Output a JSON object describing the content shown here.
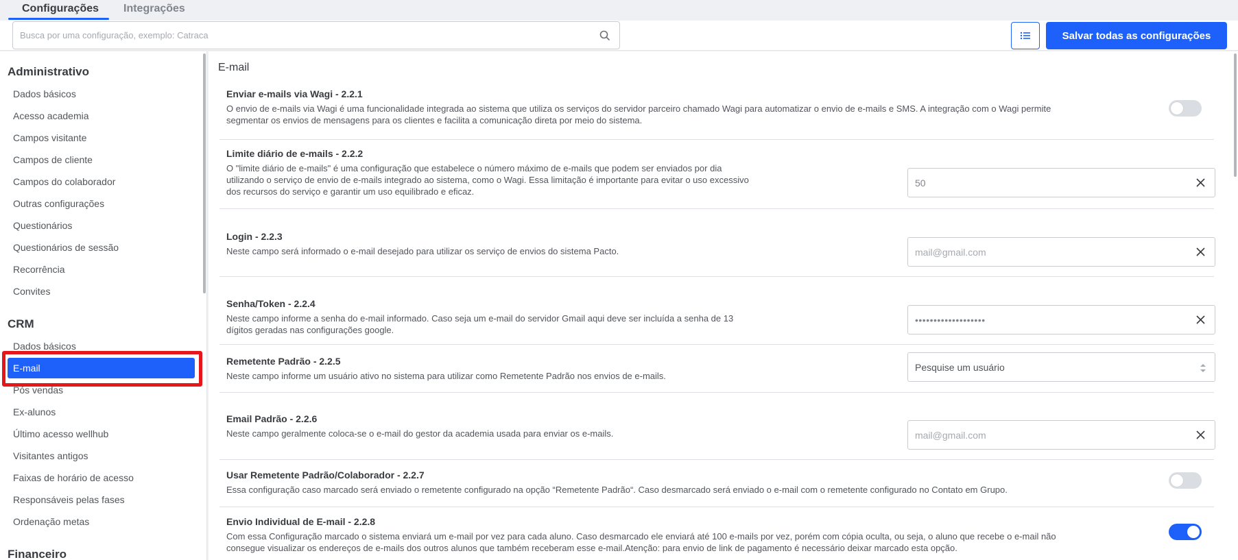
{
  "tabs": [
    {
      "label": "Configurações",
      "active": true
    },
    {
      "label": "Integrações",
      "active": false
    }
  ],
  "search": {
    "placeholder": "Busca por uma configuração, exemplo: Catraca"
  },
  "toolbar": {
    "save_label": "Salvar todas as configurações",
    "list_icon": "list-icon"
  },
  "sidebar": {
    "sections": [
      {
        "heading": "Administrativo",
        "items": [
          "Dados básicos",
          "Acesso academia",
          "Campos visitante",
          "Campos de cliente",
          "Campos do colaborador",
          "Outras configurações",
          "Questionários",
          "Questionários de sessão",
          "Recorrência",
          "Convites"
        ]
      },
      {
        "heading": "CRM",
        "items": [
          "Dados básicos",
          "E-mail",
          "Pós vendas",
          "Ex-alunos",
          "Último acesso wellhub",
          "Visitantes antigos",
          "Faixas de horário de acesso",
          "Responsáveis pelas fases",
          "Ordenação metas"
        ],
        "active_item": "E-mail"
      },
      {
        "heading": "Financeiro",
        "items": []
      }
    ]
  },
  "main": {
    "section_title": "E-mail",
    "settings": [
      {
        "title": "Enviar e-mails via Wagi - 2.2.1",
        "desc_lines": [
          "O envio de e-mails via Wagi é uma funcionalidade integrada ao sistema que utiliza os serviços do servidor parceiro chamado Wagi para automatizar o envio de e-mails e SMS. A integração com o Wagi permite",
          "segmentar os envios de mensagens para os clientes e facilita a comunicação direta por meio do sistema."
        ],
        "control": "toggle",
        "on": false
      },
      {
        "title": "Limite diário de e-mails - 2.2.2",
        "desc_lines": [
          "O \"limite diário de e-mails\" é uma configuração que estabelece o número máximo de e-mails que podem ser enviados por dia",
          "utilizando o serviço de envio de e-mails integrado ao sistema, como o Wagi. Essa limitação é importante para evitar o uso excessivo",
          "dos recursos do serviço e garantir um uso equilibrado e eficaz."
        ],
        "control": "input",
        "value": "50"
      },
      {
        "title": "Login - 2.2.3",
        "desc_lines": [
          "Neste campo será informado o e-mail desejado para utilizar os serviço de envios do sistema Pacto."
        ],
        "control": "input",
        "value": "mail@gmail.com"
      },
      {
        "title": "Senha/Token - 2.2.4",
        "desc_lines": [
          "Neste campo informe a senha do e-mail informado. Caso seja um e-mail do servidor Gmail aqui deve ser incluída a senha de 13",
          "dígitos geradas nas configurações google."
        ],
        "control": "input",
        "value": "•••••••••••••••••••"
      },
      {
        "title": "Remetente Padrão - 2.2.5",
        "desc_lines": [
          "Neste campo informe um usuário ativo no sistema para utilizar como Remetente Padrão nos envios de e-mails."
        ],
        "control": "select",
        "value": "Pesquise um usuário"
      },
      {
        "title": "Email Padrão - 2.2.6",
        "desc_lines": [
          "Neste campo geralmente coloca-se o e-mail do gestor da academia usada para enviar os e-mails."
        ],
        "control": "input",
        "value": "mail@gmail.com"
      },
      {
        "title": "Usar Remetente Padrão/Colaborador - 2.2.7",
        "desc_lines": [
          "Essa configuração caso marcado será enviado o remetente configurado na opção “Remetente Padrão“. Caso desmarcado será enviado o e-mail com o remetente configurado no Contato em Grupo."
        ],
        "control": "toggle",
        "on": false
      },
      {
        "title": "Envio Individual de E-mail - 2.2.8",
        "desc_lines": [
          "Com essa Configuração marcado o sistema enviará um e-mail por vez para cada aluno. Caso desmarcado ele enviará até 100 e-mails por vez, porém com cópia oculta, ou seja, o aluno que recebe o e-mail não",
          "consegue visualizar os endereços de e-mails dos outros alunos que também receberam esse e-mail.Atenção: para envio de link de pagamento é necessário deixar marcado esta opção."
        ],
        "control": "toggle",
        "on": true
      }
    ]
  },
  "colors": {
    "accent": "#1e60fa",
    "highlight": "#e6171b"
  }
}
